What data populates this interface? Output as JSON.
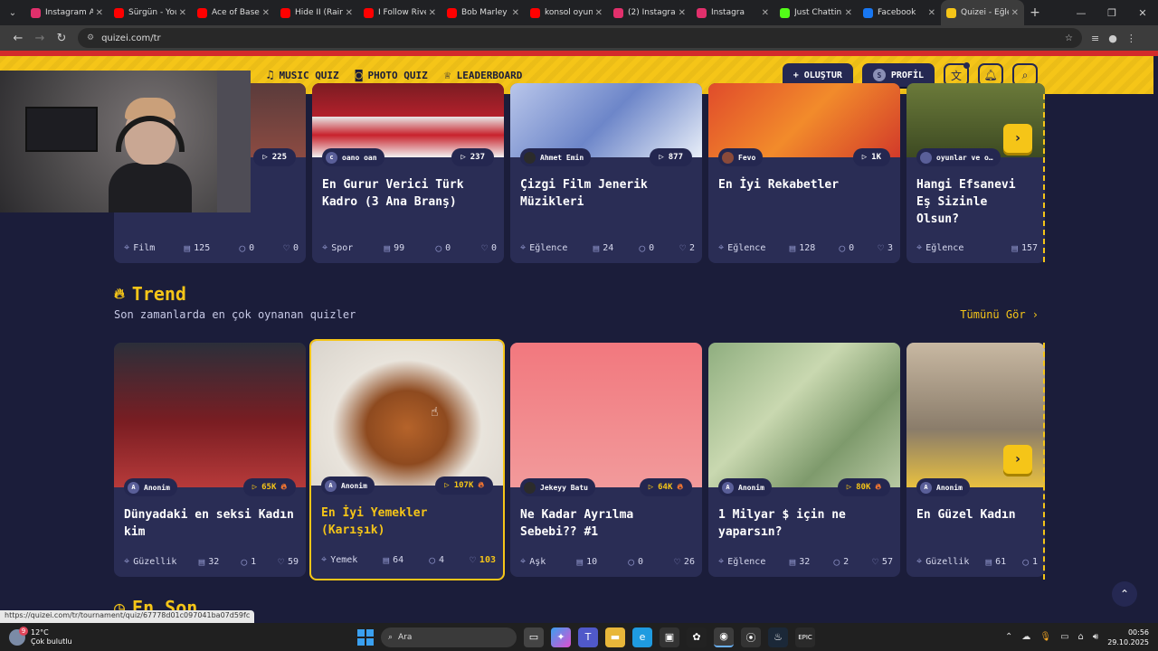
{
  "browser": {
    "tabs": [
      {
        "label": "Instagram A",
        "color": "#e1306c"
      },
      {
        "label": "Sürgün - You",
        "color": "#ff0000"
      },
      {
        "label": "Ace of Base",
        "color": "#ff0000"
      },
      {
        "label": "Hide II (Rain",
        "color": "#ff0000"
      },
      {
        "label": "I Follow Rive",
        "color": "#ff0000"
      },
      {
        "label": "Bob Marley",
        "color": "#ff0000"
      },
      {
        "label": "konsol oyun",
        "color": "#ff0000"
      },
      {
        "label": "(2) Instagram",
        "color": "#e1306c"
      },
      {
        "label": "Instagra",
        "color": "#e1306c"
      },
      {
        "label": "Just Chattin",
        "color": "#53fc18"
      },
      {
        "label": "Facebook",
        "color": "#1877f2"
      },
      {
        "label": "Quizei - Eğle",
        "color": "#f5c518"
      }
    ],
    "url": "quizei.com/tr"
  },
  "header": {
    "partial_nav": "A",
    "nav": [
      {
        "label": "MUSIC QUIZ",
        "icon": "music-icon"
      },
      {
        "label": "PHOTO QUIZ",
        "icon": "camera-icon"
      },
      {
        "label": "LEADERBOARD",
        "icon": "trophy-icon"
      }
    ],
    "create_label": "+ OLUŞTUR",
    "profile_label": "PROFİL",
    "profile_initial": "S"
  },
  "top_row": [
    {
      "partial_title": "i",
      "plays": "225",
      "category": "Film",
      "questions": "125",
      "comments": "0",
      "likes": "0"
    },
    {
      "author": "oano oan",
      "author_initial": "c",
      "plays": "237",
      "title": "En Gurur Verici Türk Kadro (3 Ana Branş)",
      "category": "Spor",
      "questions": "99",
      "comments": "0",
      "likes": "0"
    },
    {
      "author": "Ahmet Emin",
      "plays": "877",
      "title": "Çizgi Film Jenerik Müzikleri",
      "category": "Eğlence",
      "questions": "24",
      "comments": "0",
      "likes": "2"
    },
    {
      "author": "Fevo",
      "plays": "1K",
      "title": "En İyi Rekabetler",
      "category": "Eğlence",
      "questions": "128",
      "comments": "0",
      "likes": "3"
    },
    {
      "author": "oyunlar ve o…",
      "title": "Hangi Efsanevi Eş Sizinle Olsun?",
      "category": "Eğlence",
      "questions": "157"
    }
  ],
  "trend": {
    "title": "Trend",
    "subtitle": "Son zamanlarda en çok oynanan quizler",
    "see_all": "Tümünü Gör ›",
    "cards": [
      {
        "author": "Anonim",
        "author_initial": "A",
        "plays": "65K",
        "title": "Dünyadaki en seksi Kadın kim",
        "category": "Güzellik",
        "questions": "32",
        "comments": "1",
        "likes": "59"
      },
      {
        "author": "Anonim",
        "author_initial": "A",
        "plays": "107K",
        "title": "En İyi Yemekler (Karışık)",
        "category": "Yemek",
        "questions": "64",
        "comments": "4",
        "likes": "103"
      },
      {
        "author": "Jekeyy Batu",
        "plays": "64K",
        "title": "Ne Kadar Ayrılma Sebebi?? #1",
        "category": "Aşk",
        "questions": "10",
        "comments": "0",
        "likes": "26"
      },
      {
        "author": "Anonim",
        "author_initial": "A",
        "plays": "80K",
        "title": "1 Milyar $ için ne yaparsın?",
        "category": "Eğlence",
        "questions": "32",
        "comments": "2",
        "likes": "57"
      },
      {
        "author": "Anonim",
        "author_initial": "A",
        "title": "En Güzel Kadın",
        "category": "Güzellik",
        "questions": "61",
        "comments": "1"
      }
    ]
  },
  "next_section": "En Son",
  "status_url": "https://quizei.com/tr/tournament/quiz/67778d01c097041ba07d59fc",
  "taskbar": {
    "temp": "12°C",
    "weather": "Çok bulutlu",
    "weather_badge": "9",
    "search": "Ara",
    "time": "00:56",
    "date": "29.10.2025"
  }
}
